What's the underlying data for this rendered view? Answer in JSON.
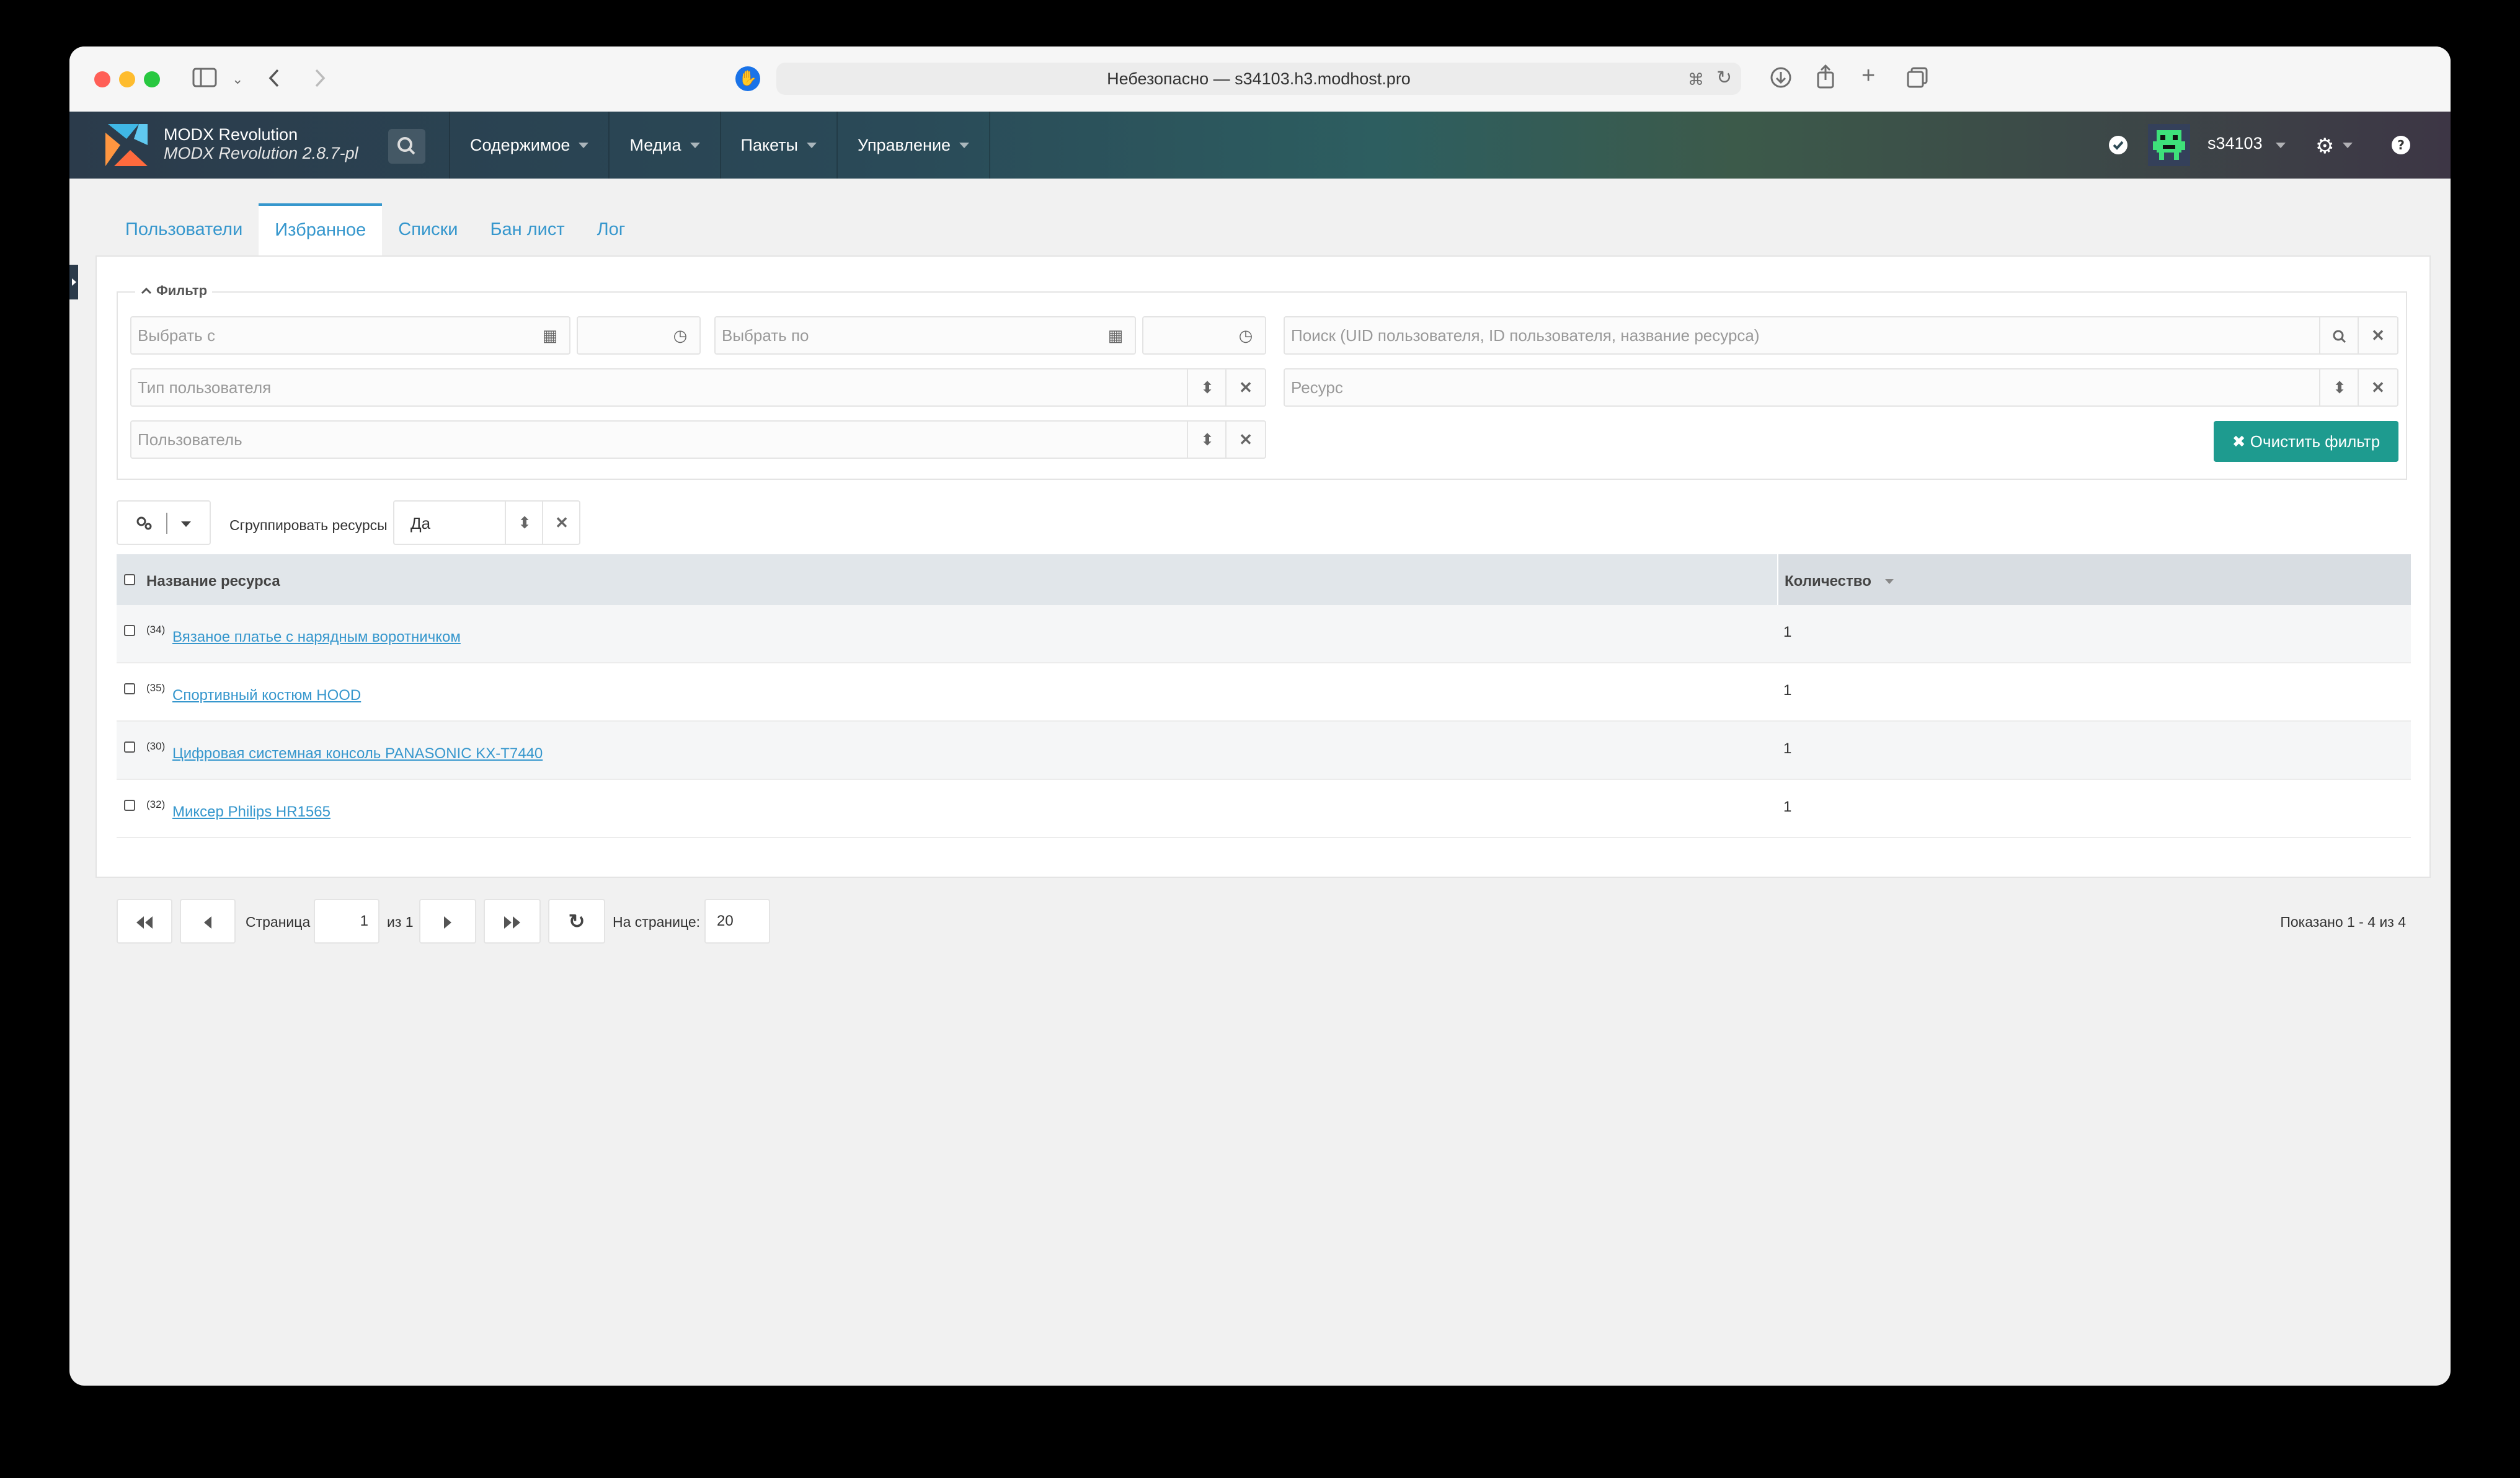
{
  "browser": {
    "url": "Небезопасно — s34103.h3.modhost.pro"
  },
  "header": {
    "brand_title": "MODX Revolution",
    "brand_version": "MODX Revolution 2.8.7-pl",
    "nav": [
      "Содержимое",
      "Медиа",
      "Пакеты",
      "Управление"
    ],
    "username": "s34103"
  },
  "tabs": [
    "Пользователи",
    "Избранное",
    "Списки",
    "Бан лист",
    "Лог"
  ],
  "filter": {
    "legend": "Фильтр",
    "date_from_placeholder": "Выбрать с",
    "date_to_placeholder": "Выбрать по",
    "search_placeholder": "Поиск (UID пользователя, ID пользователя, название ресурса)",
    "user_type_placeholder": "Тип пользователя",
    "resource_placeholder": "Ресурс",
    "user_placeholder": "Пользователь",
    "clear_label": "✖ Очистить фильтр"
  },
  "toolbar": {
    "group_label": "Сгруппировать ресурсы",
    "group_value": "Да"
  },
  "grid": {
    "columns": [
      "Название ресурса",
      "Количество"
    ],
    "rows": [
      {
        "id": "(34)",
        "name": "Вязаное платье с нарядным воротничком",
        "count": "1"
      },
      {
        "id": "(35)",
        "name": "Спортивный костюм HOOD",
        "count": "1"
      },
      {
        "id": "(30)",
        "name": "Цифровая системная консоль PANASONIC KX-T7440",
        "count": "1"
      },
      {
        "id": "(32)",
        "name": "Миксер Philips HR1565",
        "count": "1"
      }
    ]
  },
  "pager": {
    "page_label": "Страница",
    "page_value": "1",
    "of_label": "из 1",
    "per_page_label": "На странице:",
    "per_page_value": "20",
    "summary": "Показано 1 - 4 из 4"
  },
  "colors": {
    "accent": "#3697cd",
    "clear_button": "#1e9b8f"
  }
}
